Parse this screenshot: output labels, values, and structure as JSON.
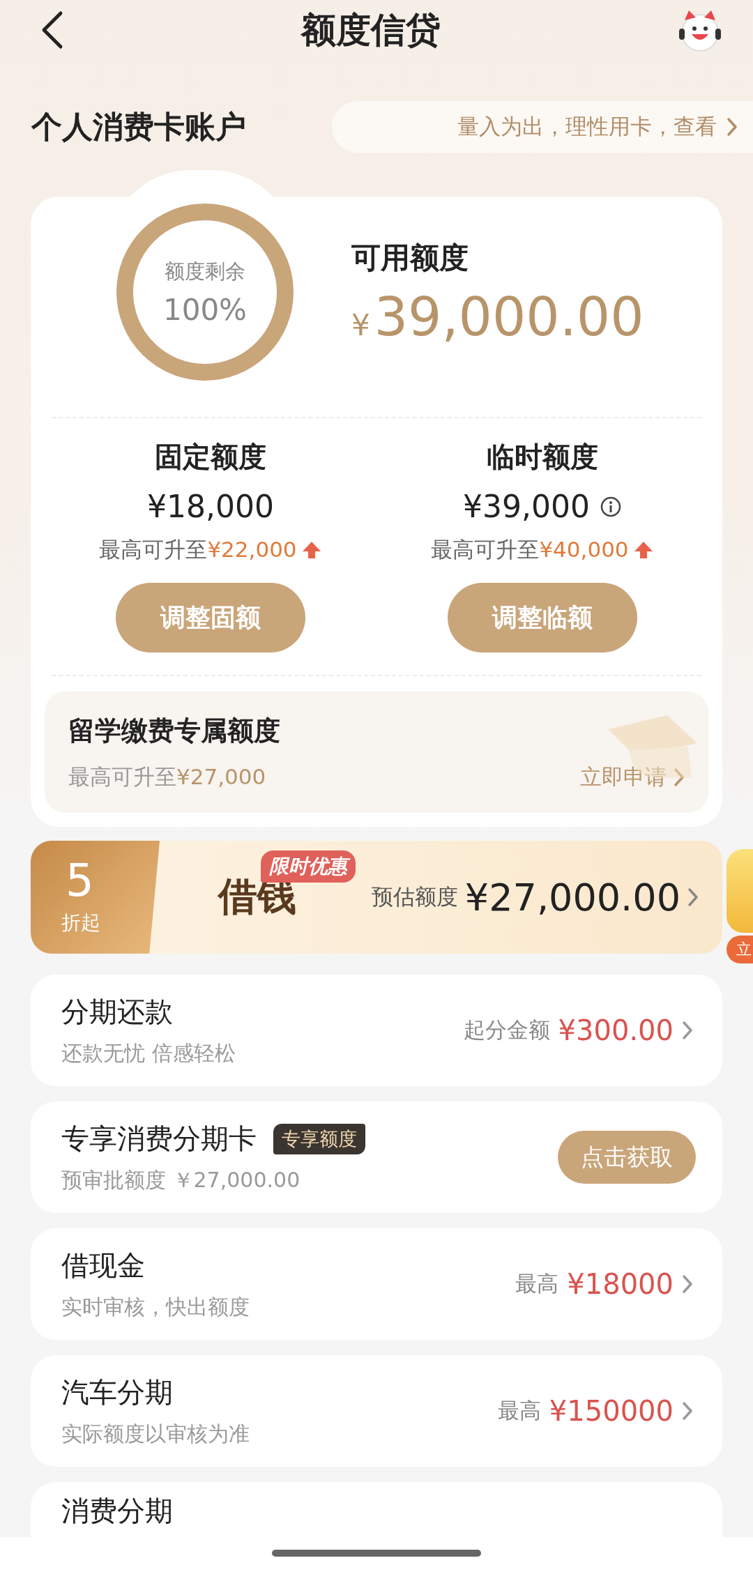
{
  "header": {
    "title": "额度信贷"
  },
  "account": {
    "title": "个人消费卡账户",
    "notice": "量入为出，理性用卡，查看"
  },
  "summary": {
    "ring": {
      "label": "额度剩余",
      "value": "100%"
    },
    "available_label": "可用额度",
    "currency": "¥",
    "amount": "39,000.00"
  },
  "limits": [
    {
      "title": "固定额度",
      "amount": "¥18,000",
      "info": false,
      "hint": "最高可升至",
      "max": "¥22,000",
      "button": "调整固额"
    },
    {
      "title": "临时额度",
      "amount": "¥39,000",
      "info": true,
      "hint": "最高可升至",
      "max": "¥40,000",
      "button": "调整临额"
    }
  ],
  "study": {
    "title": "留学缴费专属额度",
    "hint": "最高可升至",
    "max": "¥27,000",
    "action": "立即申请"
  },
  "promo": {
    "discount": "5",
    "discount_unit": "折起",
    "title": "借钱",
    "tag": "限时优惠",
    "label": "预估额度",
    "amount": "¥27,000.00"
  },
  "float_widget": {
    "button": "立"
  },
  "services": [
    {
      "kind": "link",
      "title": "分期还款",
      "subtitle": "还款无忧 倍感轻松",
      "label": "起分金额",
      "amount": "¥300.00"
    },
    {
      "kind": "button",
      "title": "专享消费分期卡",
      "badge": "专享额度",
      "subtitle": "预审批额度 ￥27,000.00",
      "button": "点击获取"
    },
    {
      "kind": "link",
      "title": "借现金",
      "subtitle": "实时审核，快出额度",
      "label": "最高",
      "amount": "¥18000"
    },
    {
      "kind": "link",
      "title": "汽车分期",
      "subtitle": "实际额度以审核为准",
      "label": "最高",
      "amount": "¥150000"
    },
    {
      "kind": "link",
      "title": "消费分期"
    }
  ]
}
